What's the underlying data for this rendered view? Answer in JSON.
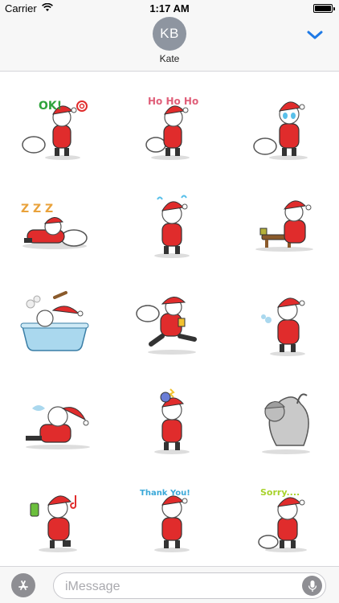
{
  "status_bar": {
    "carrier": "Carrier",
    "time": "1:17 AM"
  },
  "header": {
    "avatar_initials": "KB",
    "contact_name": "Kate"
  },
  "stickers": [
    {
      "caption": "OK!"
    },
    {
      "caption": "Ho Ho Ho"
    },
    {
      "caption": ""
    },
    {
      "caption": "Z Z Z"
    },
    {
      "caption": ""
    },
    {
      "caption": ""
    },
    {
      "caption": ""
    },
    {
      "caption": ""
    },
    {
      "caption": ""
    },
    {
      "caption": ""
    },
    {
      "caption": ""
    },
    {
      "caption": ""
    },
    {
      "caption": ""
    },
    {
      "caption": "Thank You!"
    },
    {
      "caption": "Sorry...."
    }
  ],
  "input": {
    "placeholder": "iMessage"
  },
  "colors": {
    "accent": "#1f7ae6",
    "santa_red": "#e02c2c",
    "ok_green": "#2fa33c",
    "hoho_pink": "#e0607a",
    "thank_blue": "#3aa8d8",
    "sorry_lime": "#a8d22c",
    "zzz_orange": "#e9a23b"
  },
  "icons": {
    "app_store": "app-store-icon",
    "mic": "microphone-icon",
    "chevron": "chevron-down-icon",
    "wifi": "wifi-icon",
    "battery": "battery-icon"
  }
}
